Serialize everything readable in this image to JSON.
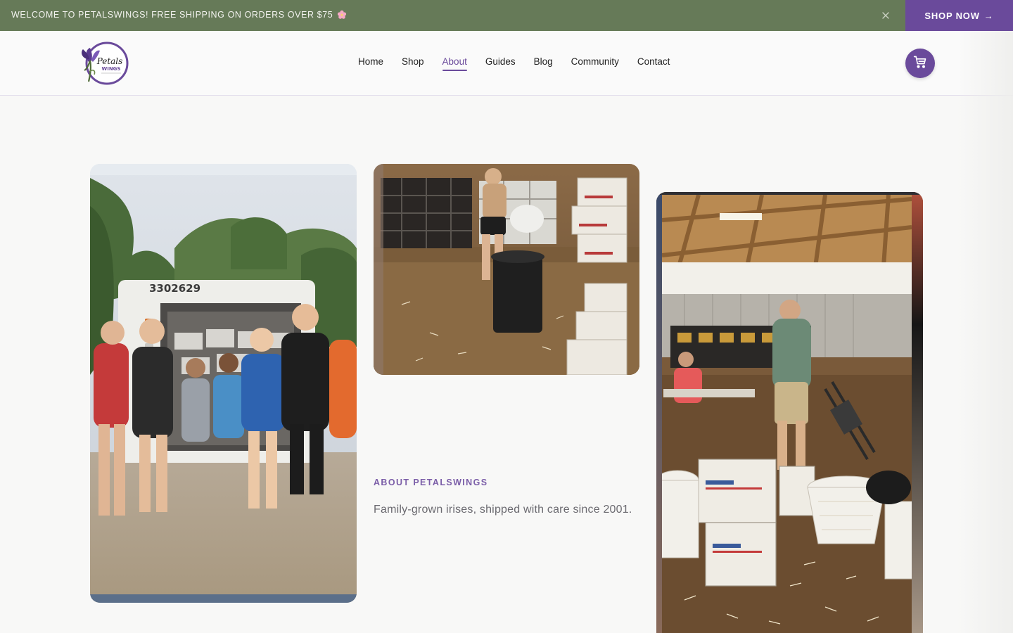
{
  "announcement": {
    "text": "WELCOME TO PETALSWINGS! FREE SHIPPING ON ORDERS OVER $75",
    "flower_icon": "cherry-blossom-icon",
    "close_icon": "close-icon",
    "cta_label": "SHOP NOW",
    "cta_arrow": "→"
  },
  "header": {
    "logo": {
      "name": "Petals Wings",
      "lines": [
        "Petals",
        "WINGS"
      ]
    },
    "nav": [
      {
        "label": "Home",
        "active": false
      },
      {
        "label": "Shop",
        "active": false
      },
      {
        "label": "About",
        "active": true
      },
      {
        "label": "Guides",
        "active": false
      },
      {
        "label": "Blog",
        "active": false
      },
      {
        "label": "Community",
        "active": false
      },
      {
        "label": "Contact",
        "active": false
      }
    ],
    "cart_icon": "shopping-cart-icon"
  },
  "about": {
    "eyebrow": "ABOUT PETALSWINGS",
    "tagline": "Family-grown irises, shipped with care since 2001.",
    "photos": [
      {
        "name": "team-photo",
        "truck_number": "3302629"
      },
      {
        "name": "warehouse-photo"
      },
      {
        "name": "barn-packing-photo"
      }
    ]
  },
  "colors": {
    "announcement_bg": "#667a58",
    "brand_purple": "#6a4a9b",
    "eyebrow": "#7b5ea8",
    "page_bg": "#f8f8f7"
  }
}
